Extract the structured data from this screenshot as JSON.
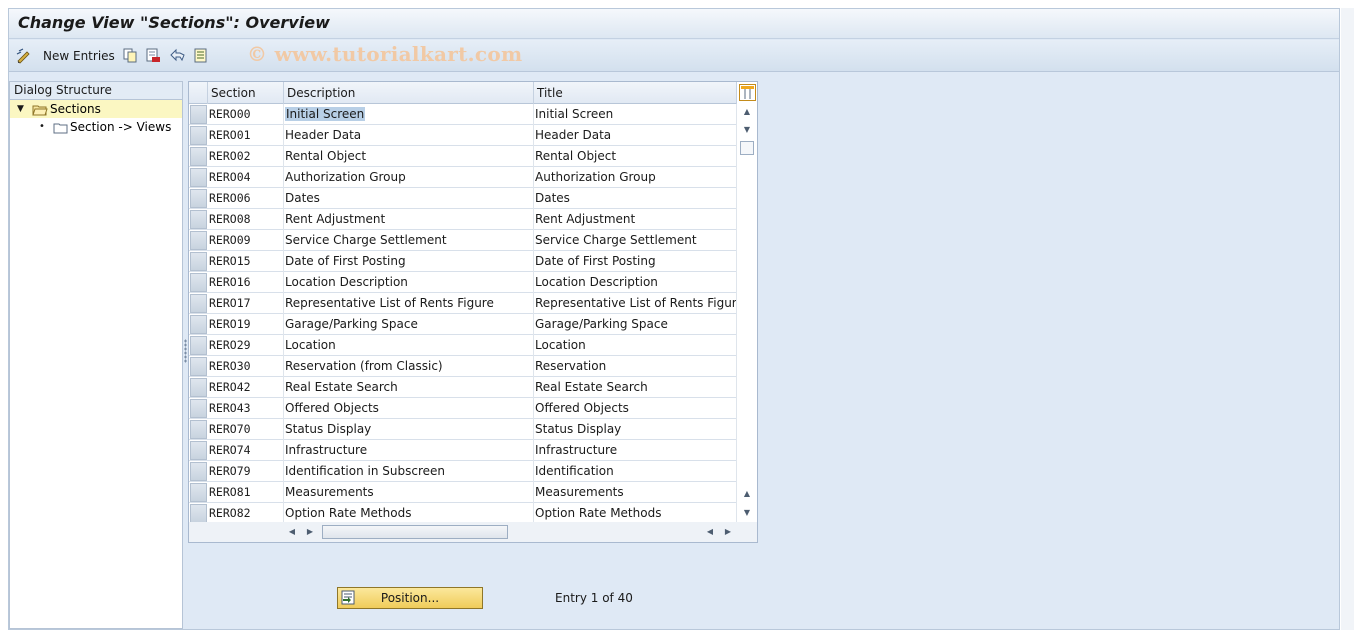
{
  "window": {
    "title": "Change View \"Sections\": Overview"
  },
  "toolbar": {
    "new_entries_label": "New Entries",
    "watermark": "© www.tutorialkart.com",
    "icons": [
      "edit-toggle-icon",
      "copy-icon",
      "delete-icon",
      "undo-icon",
      "select-all-icon"
    ]
  },
  "dialog_structure": {
    "header": "Dialog Structure",
    "items": [
      {
        "label": "Sections",
        "expanded": true,
        "selected": true
      },
      {
        "label": "Section -> Views",
        "expanded": false,
        "selected": false
      }
    ]
  },
  "table": {
    "columns": [
      "Section",
      "Description",
      "Title"
    ],
    "rows": [
      {
        "section": "RERO00",
        "description": "Initial Screen",
        "title": "Initial Screen"
      },
      {
        "section": "RERO01",
        "description": "Header Data",
        "title": "Header Data"
      },
      {
        "section": "RERO02",
        "description": "Rental Object",
        "title": "Rental Object"
      },
      {
        "section": "RERO04",
        "description": "Authorization Group",
        "title": "Authorization Group"
      },
      {
        "section": "RERO06",
        "description": "Dates",
        "title": "Dates"
      },
      {
        "section": "RERO08",
        "description": "Rent Adjustment",
        "title": "Rent Adjustment"
      },
      {
        "section": "RERO09",
        "description": "Service Charge Settlement",
        "title": "Service Charge Settlement"
      },
      {
        "section": "RERO15",
        "description": "Date of First Posting",
        "title": "Date of First Posting"
      },
      {
        "section": "RERO16",
        "description": "Location Description",
        "title": "Location Description"
      },
      {
        "section": "RERO17",
        "description": "Representative List of Rents Figure",
        "title": "Representative List of Rents Figure"
      },
      {
        "section": "RERO19",
        "description": "Garage/Parking Space",
        "title": "Garage/Parking Space"
      },
      {
        "section": "RERO29",
        "description": "Location",
        "title": "Location"
      },
      {
        "section": "RERO30",
        "description": "Reservation (from Classic)",
        "title": "Reservation"
      },
      {
        "section": "RERO42",
        "description": "Real Estate Search",
        "title": "Real Estate Search"
      },
      {
        "section": "RERO43",
        "description": "Offered Objects",
        "title": "Offered Objects"
      },
      {
        "section": "RERO70",
        "description": "Status Display",
        "title": "Status Display"
      },
      {
        "section": "RERO74",
        "description": "Infrastructure",
        "title": "Infrastructure"
      },
      {
        "section": "RERO79",
        "description": "Identification in Subscreen",
        "title": "Identification"
      },
      {
        "section": "RERO81",
        "description": "Measurements",
        "title": "Measurements"
      },
      {
        "section": "RERO82",
        "description": "Option Rate Methods",
        "title": "Option Rate Methods"
      }
    ]
  },
  "footer": {
    "position_button_label": "Position...",
    "entry_info": "Entry 1 of 40"
  },
  "colors": {
    "accent_button": "#f0cc5a",
    "frame_bg": "#dfe9f5",
    "selection": "#fbf7c2"
  }
}
